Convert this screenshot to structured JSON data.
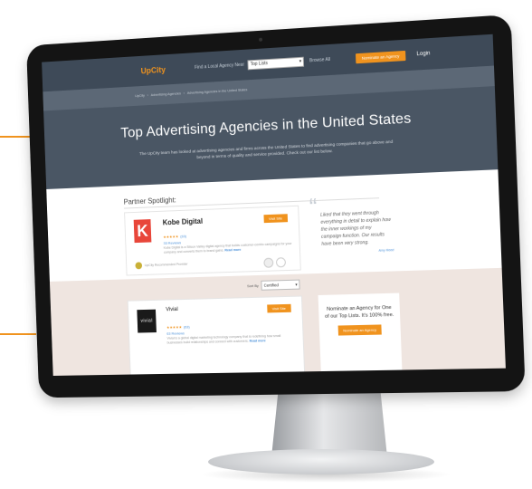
{
  "brand": {
    "accent": "#f0931e",
    "nav_bg": "#3e4a58",
    "hero_bg": "#4a5664"
  },
  "nav": {
    "logo": "UpCity",
    "find_label": "Find a Local Agency Near",
    "find_value": "Top Lists",
    "browse_label": "Browse All",
    "nominate_label": "Nominate an Agency",
    "login_label": "Login"
  },
  "breadcrumb": {
    "items": [
      "UpCity",
      "Advertising Agencies",
      "Advertising Agencies in the United States"
    ]
  },
  "hero": {
    "title": "Top Advertising Agencies in the United States",
    "subtitle": "The UpCity team has looked at advertising agencies and firms across the United States to find advertising companies that go above and beyond in terms of quality and service provided. Check out our list below."
  },
  "spotlight": {
    "heading": "Partner Spotlight:",
    "company": "Kobe Digital",
    "logo_letter": "K",
    "visit_label": "Visit Site",
    "stars": "★★★★★",
    "star_count": "(33)",
    "reviews": "33 Reviews",
    "description": "Kobe Digital is a Silicon Valley digital agency that builds customer-centric campaigns for your company and converts them to brand gains.",
    "read_more": "Read more",
    "verified": "UpCity Recommended Provider",
    "quote": "Liked that they went through everything in detail to explain how the inner workings of my campaign function. Our results have been very strong.",
    "quote_by": "Amy Reed"
  },
  "listing": {
    "sort_label": "Sort By",
    "sort_value": "Certified",
    "company": "Vivial",
    "logo_text": "vivial",
    "visit_label": "Visit Site",
    "stars": "★★★★★",
    "star_count": "(63)",
    "reviews": "63 Reviews",
    "description": "Vivial is a global digital marketing technology company that is redefining how small businesses build relationships and connect with customers.",
    "read_more": "Read more"
  },
  "nominate_box": {
    "text": "Nominate an Agency for One of our Top Lists. It's 100% free.",
    "button": "Nominate an Agency"
  }
}
